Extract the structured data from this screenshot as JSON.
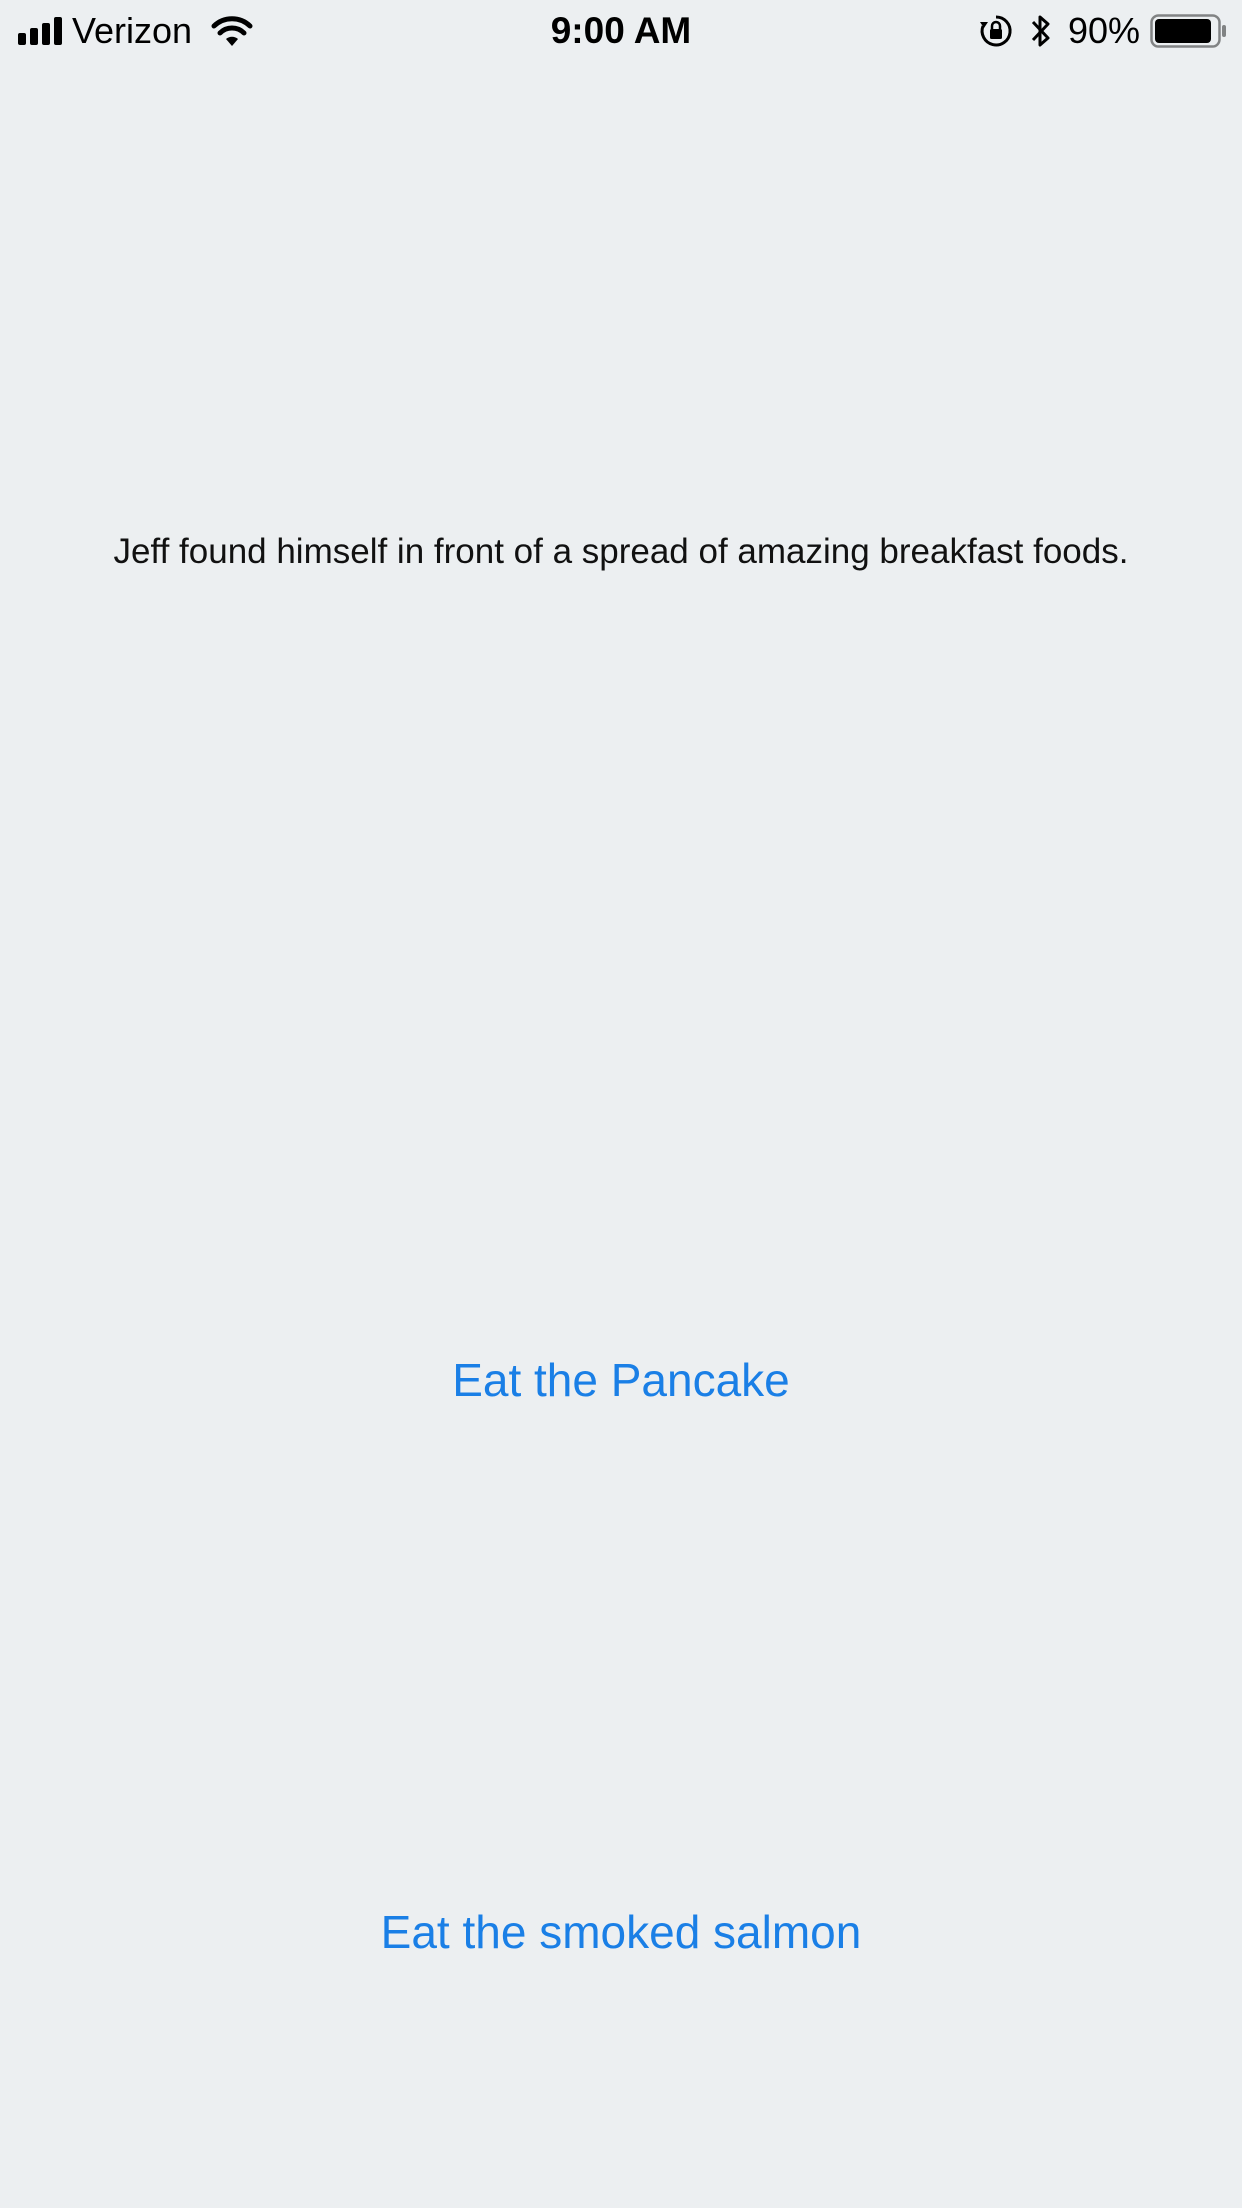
{
  "status_bar": {
    "carrier": "Verizon",
    "time": "9:00 AM",
    "battery_percent": "90%",
    "signal_bars": 4,
    "battery_level": 0.9,
    "icons": [
      "signal-icon",
      "wifi-icon",
      "rotation-lock-icon",
      "bluetooth-icon",
      "battery-icon"
    ]
  },
  "story": {
    "text": "Jeff found himself in front of a spread of amazing breakfast foods."
  },
  "choices": [
    {
      "label": "Eat the Pancake"
    },
    {
      "label": "Eat the smoked salmon"
    }
  ],
  "colors": {
    "background": "#eceff1",
    "link": "#1a7fe6",
    "text": "#111111"
  }
}
